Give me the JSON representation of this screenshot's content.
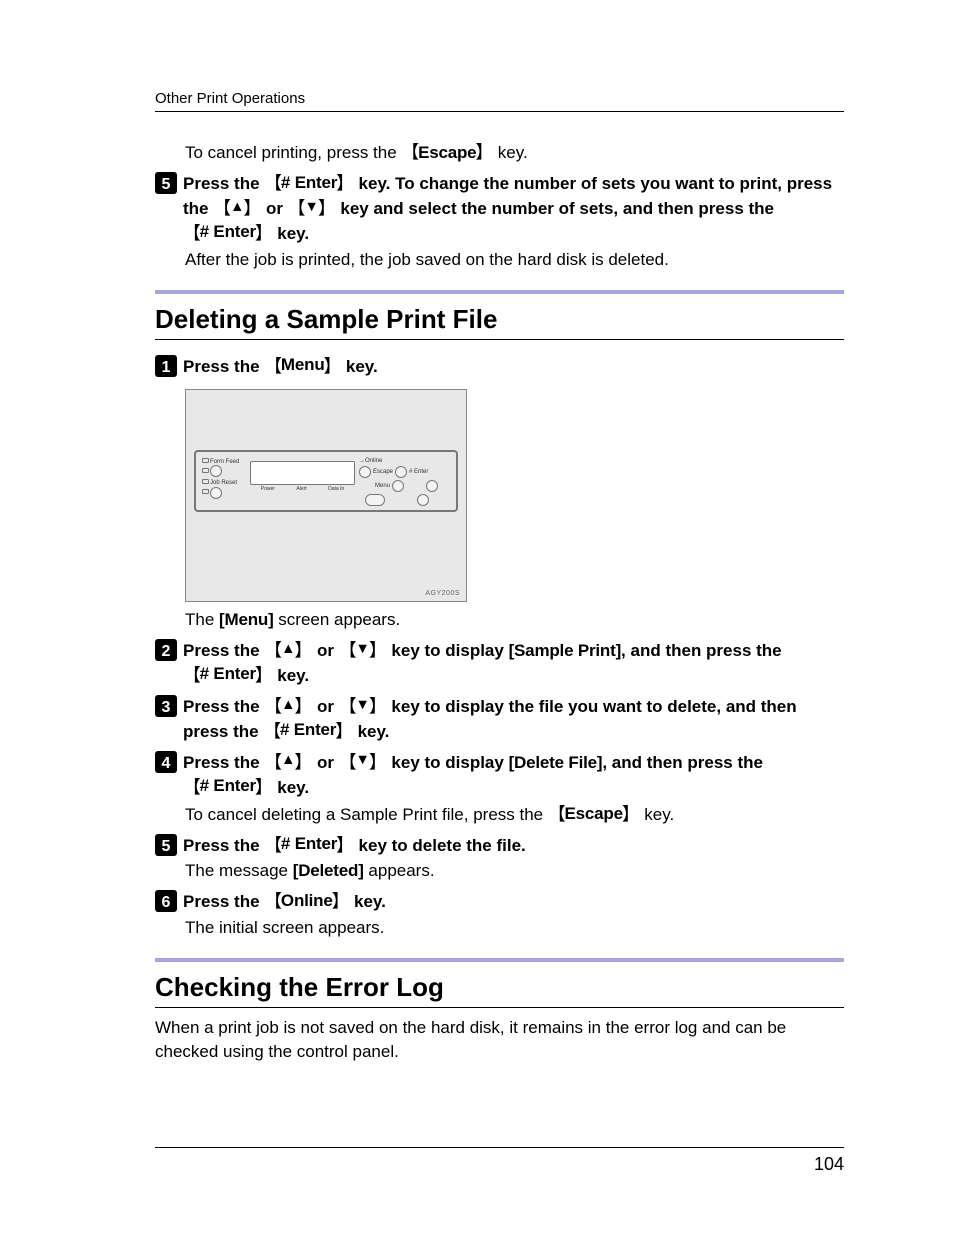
{
  "header": {
    "section": "Other Print Operations"
  },
  "page_number": "104",
  "intro": {
    "cancel_prefix": "To cancel printing, press the ",
    "escape_key": "Escape",
    "key_suffix": " key."
  },
  "step5a": {
    "prefix": "Press the ",
    "enter_key": "# Enter",
    "mid1": " key. To change the number of sets you want to print, press the ",
    "mid2": " or ",
    "mid3": " key and select the number of sets, and then press the ",
    "tail": " key.",
    "after": "After the job is printed, the job saved on the hard disk is deleted."
  },
  "section1": "Deleting a Sample Print File",
  "d1": {
    "prefix": "Press the ",
    "menu_key": "Menu",
    "suffix": " key."
  },
  "panel": {
    "form_feed": "Form Feed",
    "job_reset": "Job Reset",
    "power": "Power",
    "alert": "Alert",
    "data_in": "Data In",
    "online": "Online",
    "escape": "Escape",
    "enter": "# Enter",
    "menu": "Menu",
    "code": "AGY200S"
  },
  "d1_after_prefix": "The ",
  "d1_after_label": "Menu",
  "d1_after_suffix": " screen appears.",
  "d2": {
    "prefix": "Press the ",
    "or": " or ",
    "mid": " key to display ",
    "sample_print": "Sample Print",
    "mid2": ", and then press the ",
    "enter_key": "# Enter",
    "suffix": " key."
  },
  "d3": {
    "prefix": "Press the ",
    "or": " or ",
    "mid": " key to display the file you want to delete, and then press the ",
    "enter_key": "# Enter",
    "suffix": " key."
  },
  "d4": {
    "prefix": "Press the ",
    "or": " or ",
    "mid": " key to display ",
    "delete_file": "Delete File",
    "mid2": ", and then press the ",
    "enter_key": "# Enter",
    "suffix": " key.",
    "cancel_prefix": "To cancel deleting a Sample Print file, press the ",
    "escape_key": "Escape",
    "cancel_suffix": " key."
  },
  "d5": {
    "prefix": "Press the ",
    "enter_key": "# Enter",
    "suffix": " key to delete the file.",
    "msg_prefix": "The message ",
    "deleted": "Deleted",
    "msg_suffix": " appears."
  },
  "d6": {
    "prefix": "Press the ",
    "online_key": "Online",
    "suffix": " key.",
    "after": "The initial screen appears."
  },
  "section2": "Checking the Error Log",
  "errlog_body": "When a print job is not saved on the hard disk, it remains in the error log and can be checked using the control panel."
}
